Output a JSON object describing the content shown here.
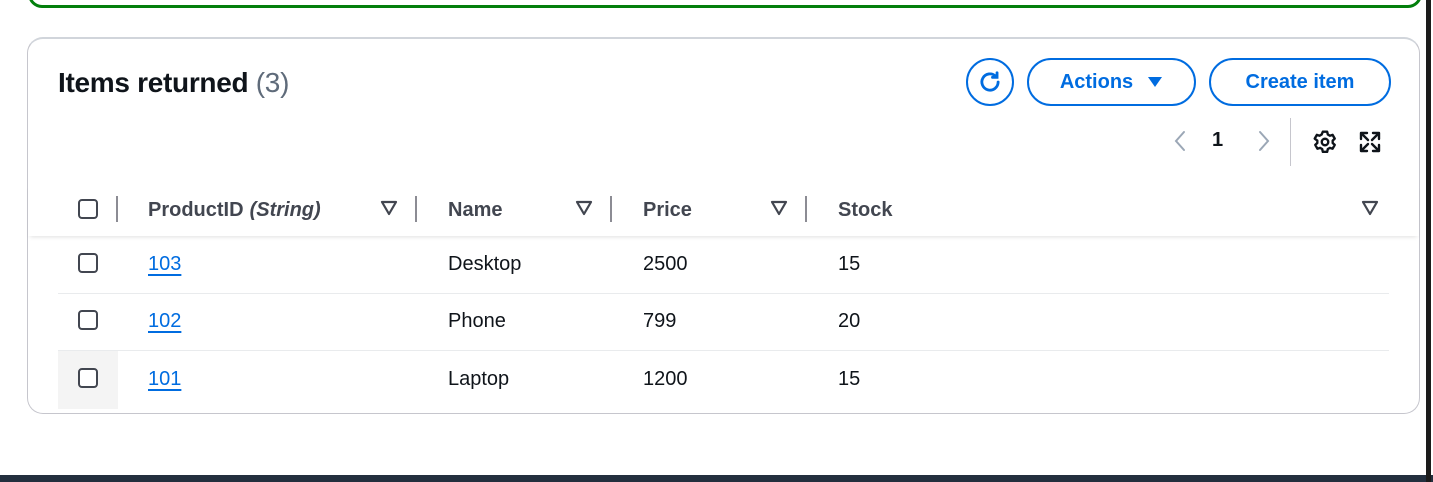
{
  "panel": {
    "title": "Items returned",
    "count": "(3)"
  },
  "toolbar": {
    "refresh_icon": "refresh-icon",
    "actions_label": "Actions",
    "create_label": "Create item"
  },
  "pagination": {
    "current_page": "1"
  },
  "table": {
    "columns": [
      {
        "label": "ProductID",
        "type": "(String)"
      },
      {
        "label": "Name"
      },
      {
        "label": "Price"
      },
      {
        "label": "Stock"
      }
    ],
    "rows": [
      {
        "product_id": "103",
        "name": "Desktop",
        "price": "2500",
        "stock": "15"
      },
      {
        "product_id": "102",
        "name": "Phone",
        "price": "799",
        "stock": "20"
      },
      {
        "product_id": "101",
        "name": "Laptop",
        "price": "1200",
        "stock": "15"
      }
    ]
  },
  "colors": {
    "accent": "#006ce0",
    "success_border": "#037f0c",
    "text": "#0f141a"
  }
}
